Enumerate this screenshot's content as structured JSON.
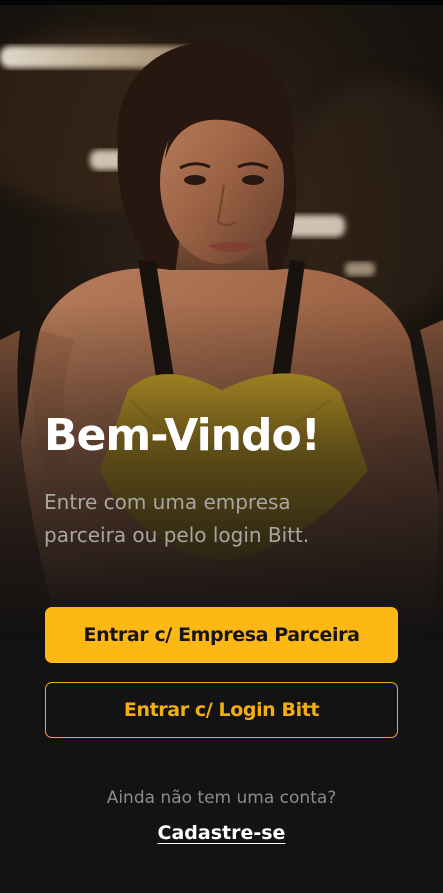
{
  "hero": {
    "image_alt": "woman in yellow sports top in gym",
    "accent_color": "#fdb813"
  },
  "welcome": {
    "title": "Bem-Vindo!",
    "subtitle": "Entre com uma empresa parceira ou pelo login Bitt."
  },
  "actions": {
    "partner_login_label": "Entrar c/ Empresa Parceira",
    "bitt_login_label": "Entrar c/ Login Bitt"
  },
  "footer": {
    "no_account_text": "Ainda não tem uma conta?",
    "signup_label": "Cadastre-se"
  }
}
